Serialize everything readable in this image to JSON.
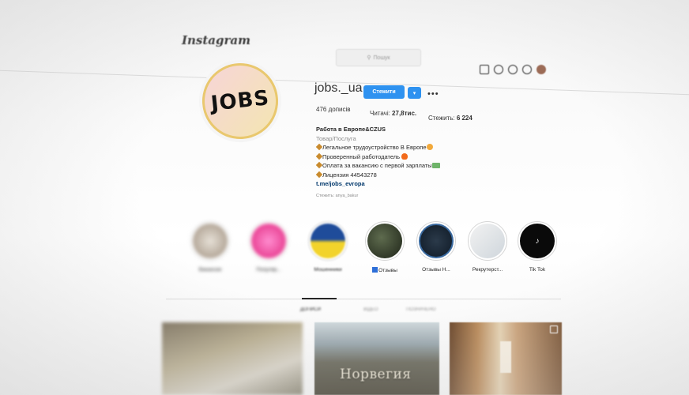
{
  "app": {
    "logo": "Instagram"
  },
  "search": {
    "placeholder": "Пошук"
  },
  "nav_icons": [
    "home-icon",
    "messenger-icon",
    "explore-icon",
    "heart-icon",
    "avatar"
  ],
  "profile": {
    "username": "jobs._ua",
    "follow_label": "Стежити",
    "posts": "476 дописів",
    "followers_label": "Читачі: ",
    "followers_value": "27,8тис.",
    "following_label": "Стежить: ",
    "following_value": "6 224",
    "avatar_text": "JOBS"
  },
  "bio": {
    "name": "Работа в Европе&CZUS",
    "category": "Товар/Послуга",
    "lines": [
      "Легальное трудоустройство В Европе",
      "Проверенный работодатель",
      "Оплата за вакансию с первой зарплаты",
      "Лицензия 44543278"
    ],
    "link": "t.me/jobs_evropa",
    "followed_by": "Стежить: anya_bakur"
  },
  "highlights": [
    {
      "label": "Вакансии"
    },
    {
      "label": "Популяр..."
    },
    {
      "label": "Мошенники"
    },
    {
      "label": "Отзывы"
    },
    {
      "label": "Отзывы Н..."
    },
    {
      "label": "Рекрутерст..."
    },
    {
      "label": "Tik Tok"
    }
  ],
  "tabs": {
    "posts": "ДОПИСИ",
    "reels": "ВІДЕО",
    "tagged": "ПОЗНАЧЕНО"
  },
  "posts": [
    {
      "caption": ""
    },
    {
      "caption": "Норвегия"
    },
    {
      "caption": ""
    }
  ],
  "colors": {
    "accent": "#2e92f0",
    "link": "#00376b"
  }
}
